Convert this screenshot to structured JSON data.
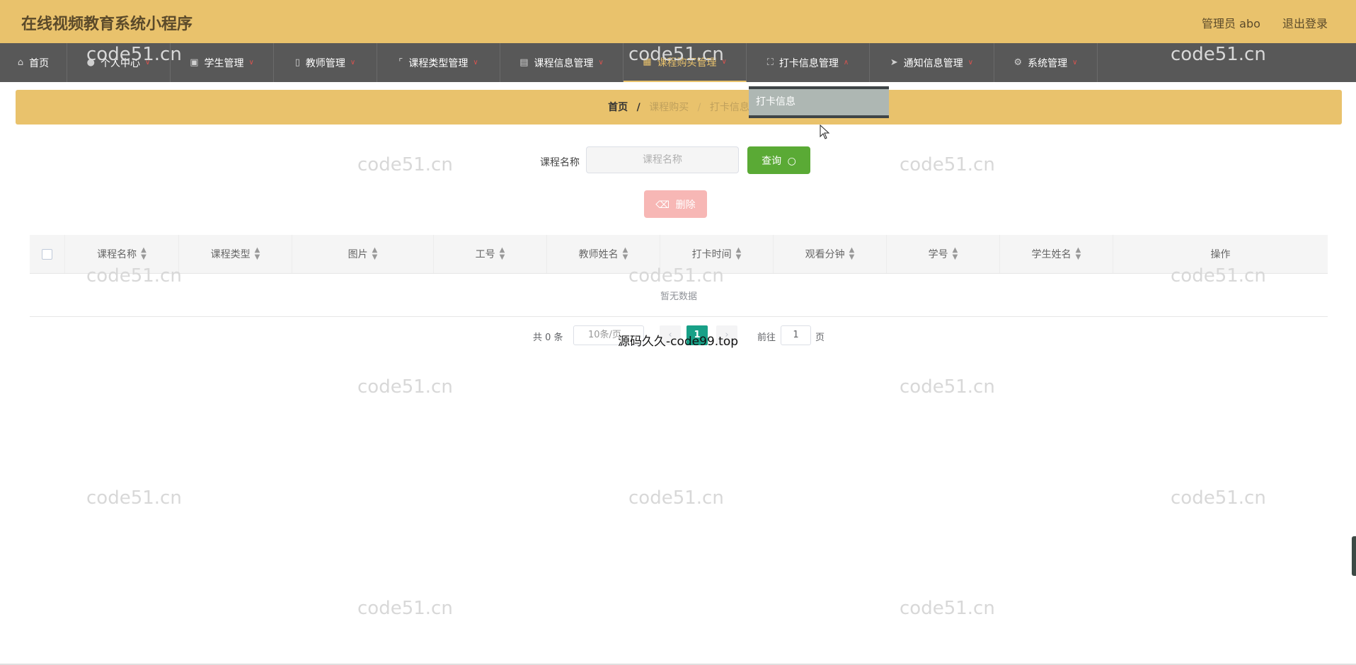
{
  "header": {
    "title": "在线视频教育系统小程序",
    "user_label": "管理员 abo",
    "logout_label": "退出登录"
  },
  "nav": {
    "items": [
      {
        "label": "首页",
        "icon": "home-icon"
      },
      {
        "label": "个人中心",
        "icon": "user-icon"
      },
      {
        "label": "学生管理",
        "icon": "card-icon"
      },
      {
        "label": "教师管理",
        "icon": "mic-icon"
      },
      {
        "label": "课程类型管理",
        "icon": "crop-icon"
      },
      {
        "label": "课程信息管理",
        "icon": "clipboard-icon"
      },
      {
        "label": "课程购买管理",
        "icon": "cart-icon"
      },
      {
        "label": "打卡信息管理",
        "icon": "fullscreen-icon"
      },
      {
        "label": "通知信息管理",
        "icon": "send-icon"
      },
      {
        "label": "系统管理",
        "icon": "settings-icon"
      }
    ],
    "active_index": 6,
    "open_index": 7,
    "dropdown": {
      "items": [
        "打卡信息"
      ]
    }
  },
  "breadcrumb": {
    "home": "首页",
    "separator": "/",
    "level1": "课程购买",
    "level2": "打卡信息"
  },
  "search": {
    "label": "课程名称",
    "placeholder": "课程名称",
    "value": "",
    "query_label": "查询"
  },
  "actions": {
    "delete_label": "删除"
  },
  "table": {
    "columns": [
      "课程名称",
      "课程类型",
      "图片",
      "工号",
      "教师姓名",
      "打卡时间",
      "观看分钟",
      "学号",
      "学生姓名",
      "操作"
    ],
    "empty_text": "暂无数据"
  },
  "pagination": {
    "total_text": "共 0 条",
    "page_size": "10条/页",
    "current_page": "1",
    "goto_label": "前往",
    "goto_value": "1",
    "page_unit": "页"
  },
  "overlay_text": "源码久久-code99.top",
  "watermark": "code51.cn",
  "colors": {
    "header_bg": "#e9c26c",
    "nav_bg": "#585858",
    "active_nav": "#e9c26c",
    "query_button": "#5aaa35",
    "delete_button": "#f7b7b5",
    "page_active": "#18a087"
  }
}
